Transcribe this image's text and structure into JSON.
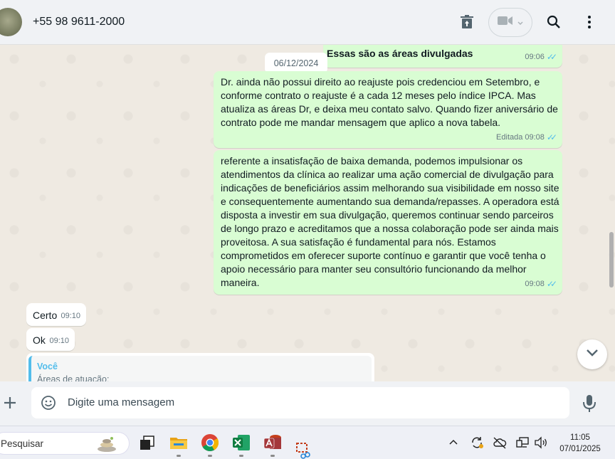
{
  "header": {
    "contact_name": "+55 98 9611-2000"
  },
  "chat": {
    "date_label": "06/12/2024",
    "messages": [
      {
        "direction": "out",
        "text": "Essas são as áreas divulgadas",
        "time": "09:06",
        "edited": ""
      },
      {
        "direction": "out",
        "text": "Dr. ainda não possui direito ao reajuste pois credenciou em Setembro, e conforme contrato o reajuste é a cada 12 meses pelo índice IPCA. Mas atualiza as áreas Dr, e deixa meu contato salvo. Quando fizer aniversário de contrato pode me mandar mensagem que aplico a nova tabela.",
        "time": "09:08",
        "edited": "Editada"
      },
      {
        "direction": "out",
        "text": "referente a insatisfação de baixa demanda, podemos impulsionar os atendimentos da clínica ao realizar uma ação comercial de divulgação para indicações de beneficiários assim melhorando sua visibilidade em nosso site e consequentemente aumentando sua demanda/repasses. A operadora está disposta a investir em sua divulgação, queremos continuar sendo parceiros de longo prazo e acreditamos que a nossa colaboração pode ser ainda mais proveitosa. A sua satisfação é fundamental para nós. Estamos comprometidos em oferecer suporte contínuo e garantir que você tenha o apoio necessário para manter seu consultório funcionando da melhor maneira.",
        "time": "09:08",
        "edited": ""
      },
      {
        "direction": "in",
        "text": "Certo",
        "time": "09:10"
      },
      {
        "direction": "in",
        "text": "Ok",
        "time": "09:10"
      }
    ],
    "quoted": {
      "author": "Você",
      "text": "Áreas de atuação:"
    }
  },
  "composer": {
    "placeholder": "Digite uma mensagem"
  },
  "taskbar": {
    "search_placeholder": "Pesquisar",
    "time": "11:05",
    "date": "07/01/2025"
  },
  "colors": {
    "outgoing_bubble": "#d9fdd3",
    "incoming_bubble": "#ffffff",
    "read_ticks": "#53bdeb",
    "quote_accent": "#53bdeb"
  }
}
